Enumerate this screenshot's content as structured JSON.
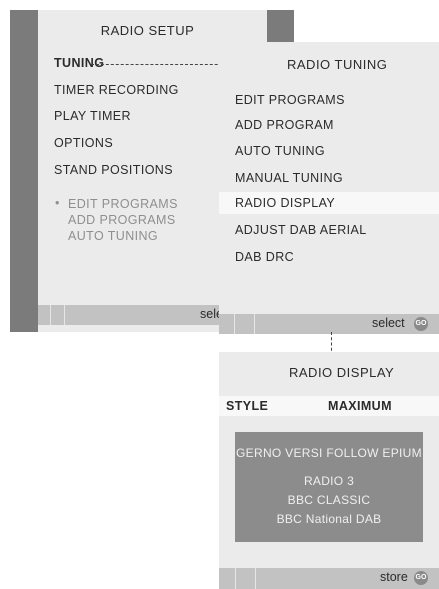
{
  "radio_setup": {
    "title": "RADIO SETUP",
    "items": [
      "TUNING",
      "TIMER RECORDING",
      "PLAY TIMER",
      "OPTIONS",
      "STAND POSITIONS"
    ],
    "subitems": [
      "EDIT PROGRAMS",
      "ADD PROGRAMS",
      "AUTO TUNING"
    ],
    "bullet": "•",
    "status_label": "select"
  },
  "radio_tuning": {
    "title": "RADIO TUNING",
    "items": [
      "EDIT PROGRAMS",
      "ADD PROGRAM",
      "AUTO TUNING",
      "MANUAL TUNING",
      "RADIO DISPLAY",
      "ADJUST DAB AERIAL",
      "DAB DRC"
    ],
    "status_label": "select",
    "go_label": "GO"
  },
  "radio_display": {
    "title": "RADIO DISPLAY",
    "style_label": "STYLE",
    "style_value": "MAXIMUM",
    "display_lines": [
      "GERNO VERSI FOLLOW EPIUM",
      "RADIO 3",
      "BBC CLASSIC",
      "BBC National DAB"
    ],
    "status_label": "store",
    "go_label": "GO"
  },
  "colors": {
    "panel_bg": "#ebebeb",
    "edge": "#7b7b7b",
    "status_bar": "#c2c2c2",
    "highlight": "#f8f8f8",
    "display_bg": "#8c8c8c",
    "sub_text": "#8f8f8f"
  }
}
